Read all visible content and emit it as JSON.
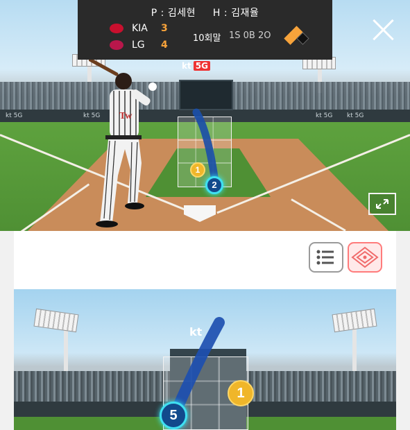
{
  "header": {
    "pitcher": "P : 김세현",
    "hitter": "H : 김재율"
  },
  "teams": [
    {
      "name": "KIA",
      "score": "3",
      "logo_icon": "tigers-logo-icon"
    },
    {
      "name": "LG",
      "score": "4",
      "logo_icon": "twins-logo-icon"
    }
  ],
  "game_state": {
    "inning": "10회말",
    "count": "1S 0B 2O",
    "bases_icon": "base-runner-diamond-icon",
    "accent_color": "#f7a33b"
  },
  "top_view": {
    "sign_text": "kt",
    "sign_badge": "5G",
    "wall_text": "kt 5G",
    "pitches": [
      {
        "number": "1",
        "type": "strike",
        "color": "#f0b62a"
      },
      {
        "number": "2",
        "type": "ball",
        "color": "#124a8c"
      }
    ]
  },
  "controls": {
    "close_icon": "close-icon",
    "expand_icon": "expand-icon",
    "list_view_icon": "list-icon",
    "field_view_icon": "field-view-icon"
  },
  "bottom_view": {
    "sign_text": "kt",
    "pitches": [
      {
        "number": "1",
        "color": "#f0b62a"
      },
      {
        "number": "5",
        "color": "#124a8c"
      }
    ]
  }
}
